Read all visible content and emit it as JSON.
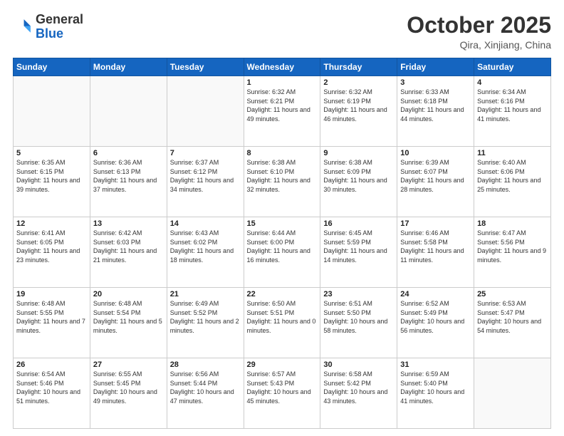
{
  "header": {
    "logo_general": "General",
    "logo_blue": "Blue",
    "month": "October 2025",
    "location": "Qira, Xinjiang, China"
  },
  "days_of_week": [
    "Sunday",
    "Monday",
    "Tuesday",
    "Wednesday",
    "Thursday",
    "Friday",
    "Saturday"
  ],
  "weeks": [
    [
      {
        "day": "",
        "info": ""
      },
      {
        "day": "",
        "info": ""
      },
      {
        "day": "",
        "info": ""
      },
      {
        "day": "1",
        "info": "Sunrise: 6:32 AM\nSunset: 6:21 PM\nDaylight: 11 hours and 49 minutes."
      },
      {
        "day": "2",
        "info": "Sunrise: 6:32 AM\nSunset: 6:19 PM\nDaylight: 11 hours and 46 minutes."
      },
      {
        "day": "3",
        "info": "Sunrise: 6:33 AM\nSunset: 6:18 PM\nDaylight: 11 hours and 44 minutes."
      },
      {
        "day": "4",
        "info": "Sunrise: 6:34 AM\nSunset: 6:16 PM\nDaylight: 11 hours and 41 minutes."
      }
    ],
    [
      {
        "day": "5",
        "info": "Sunrise: 6:35 AM\nSunset: 6:15 PM\nDaylight: 11 hours and 39 minutes."
      },
      {
        "day": "6",
        "info": "Sunrise: 6:36 AM\nSunset: 6:13 PM\nDaylight: 11 hours and 37 minutes."
      },
      {
        "day": "7",
        "info": "Sunrise: 6:37 AM\nSunset: 6:12 PM\nDaylight: 11 hours and 34 minutes."
      },
      {
        "day": "8",
        "info": "Sunrise: 6:38 AM\nSunset: 6:10 PM\nDaylight: 11 hours and 32 minutes."
      },
      {
        "day": "9",
        "info": "Sunrise: 6:38 AM\nSunset: 6:09 PM\nDaylight: 11 hours and 30 minutes."
      },
      {
        "day": "10",
        "info": "Sunrise: 6:39 AM\nSunset: 6:07 PM\nDaylight: 11 hours and 28 minutes."
      },
      {
        "day": "11",
        "info": "Sunrise: 6:40 AM\nSunset: 6:06 PM\nDaylight: 11 hours and 25 minutes."
      }
    ],
    [
      {
        "day": "12",
        "info": "Sunrise: 6:41 AM\nSunset: 6:05 PM\nDaylight: 11 hours and 23 minutes."
      },
      {
        "day": "13",
        "info": "Sunrise: 6:42 AM\nSunset: 6:03 PM\nDaylight: 11 hours and 21 minutes."
      },
      {
        "day": "14",
        "info": "Sunrise: 6:43 AM\nSunset: 6:02 PM\nDaylight: 11 hours and 18 minutes."
      },
      {
        "day": "15",
        "info": "Sunrise: 6:44 AM\nSunset: 6:00 PM\nDaylight: 11 hours and 16 minutes."
      },
      {
        "day": "16",
        "info": "Sunrise: 6:45 AM\nSunset: 5:59 PM\nDaylight: 11 hours and 14 minutes."
      },
      {
        "day": "17",
        "info": "Sunrise: 6:46 AM\nSunset: 5:58 PM\nDaylight: 11 hours and 11 minutes."
      },
      {
        "day": "18",
        "info": "Sunrise: 6:47 AM\nSunset: 5:56 PM\nDaylight: 11 hours and 9 minutes."
      }
    ],
    [
      {
        "day": "19",
        "info": "Sunrise: 6:48 AM\nSunset: 5:55 PM\nDaylight: 11 hours and 7 minutes."
      },
      {
        "day": "20",
        "info": "Sunrise: 6:48 AM\nSunset: 5:54 PM\nDaylight: 11 hours and 5 minutes."
      },
      {
        "day": "21",
        "info": "Sunrise: 6:49 AM\nSunset: 5:52 PM\nDaylight: 11 hours and 2 minutes."
      },
      {
        "day": "22",
        "info": "Sunrise: 6:50 AM\nSunset: 5:51 PM\nDaylight: 11 hours and 0 minutes."
      },
      {
        "day": "23",
        "info": "Sunrise: 6:51 AM\nSunset: 5:50 PM\nDaylight: 10 hours and 58 minutes."
      },
      {
        "day": "24",
        "info": "Sunrise: 6:52 AM\nSunset: 5:49 PM\nDaylight: 10 hours and 56 minutes."
      },
      {
        "day": "25",
        "info": "Sunrise: 6:53 AM\nSunset: 5:47 PM\nDaylight: 10 hours and 54 minutes."
      }
    ],
    [
      {
        "day": "26",
        "info": "Sunrise: 6:54 AM\nSunset: 5:46 PM\nDaylight: 10 hours and 51 minutes."
      },
      {
        "day": "27",
        "info": "Sunrise: 6:55 AM\nSunset: 5:45 PM\nDaylight: 10 hours and 49 minutes."
      },
      {
        "day": "28",
        "info": "Sunrise: 6:56 AM\nSunset: 5:44 PM\nDaylight: 10 hours and 47 minutes."
      },
      {
        "day": "29",
        "info": "Sunrise: 6:57 AM\nSunset: 5:43 PM\nDaylight: 10 hours and 45 minutes."
      },
      {
        "day": "30",
        "info": "Sunrise: 6:58 AM\nSunset: 5:42 PM\nDaylight: 10 hours and 43 minutes."
      },
      {
        "day": "31",
        "info": "Sunrise: 6:59 AM\nSunset: 5:40 PM\nDaylight: 10 hours and 41 minutes."
      },
      {
        "day": "",
        "info": ""
      }
    ]
  ]
}
